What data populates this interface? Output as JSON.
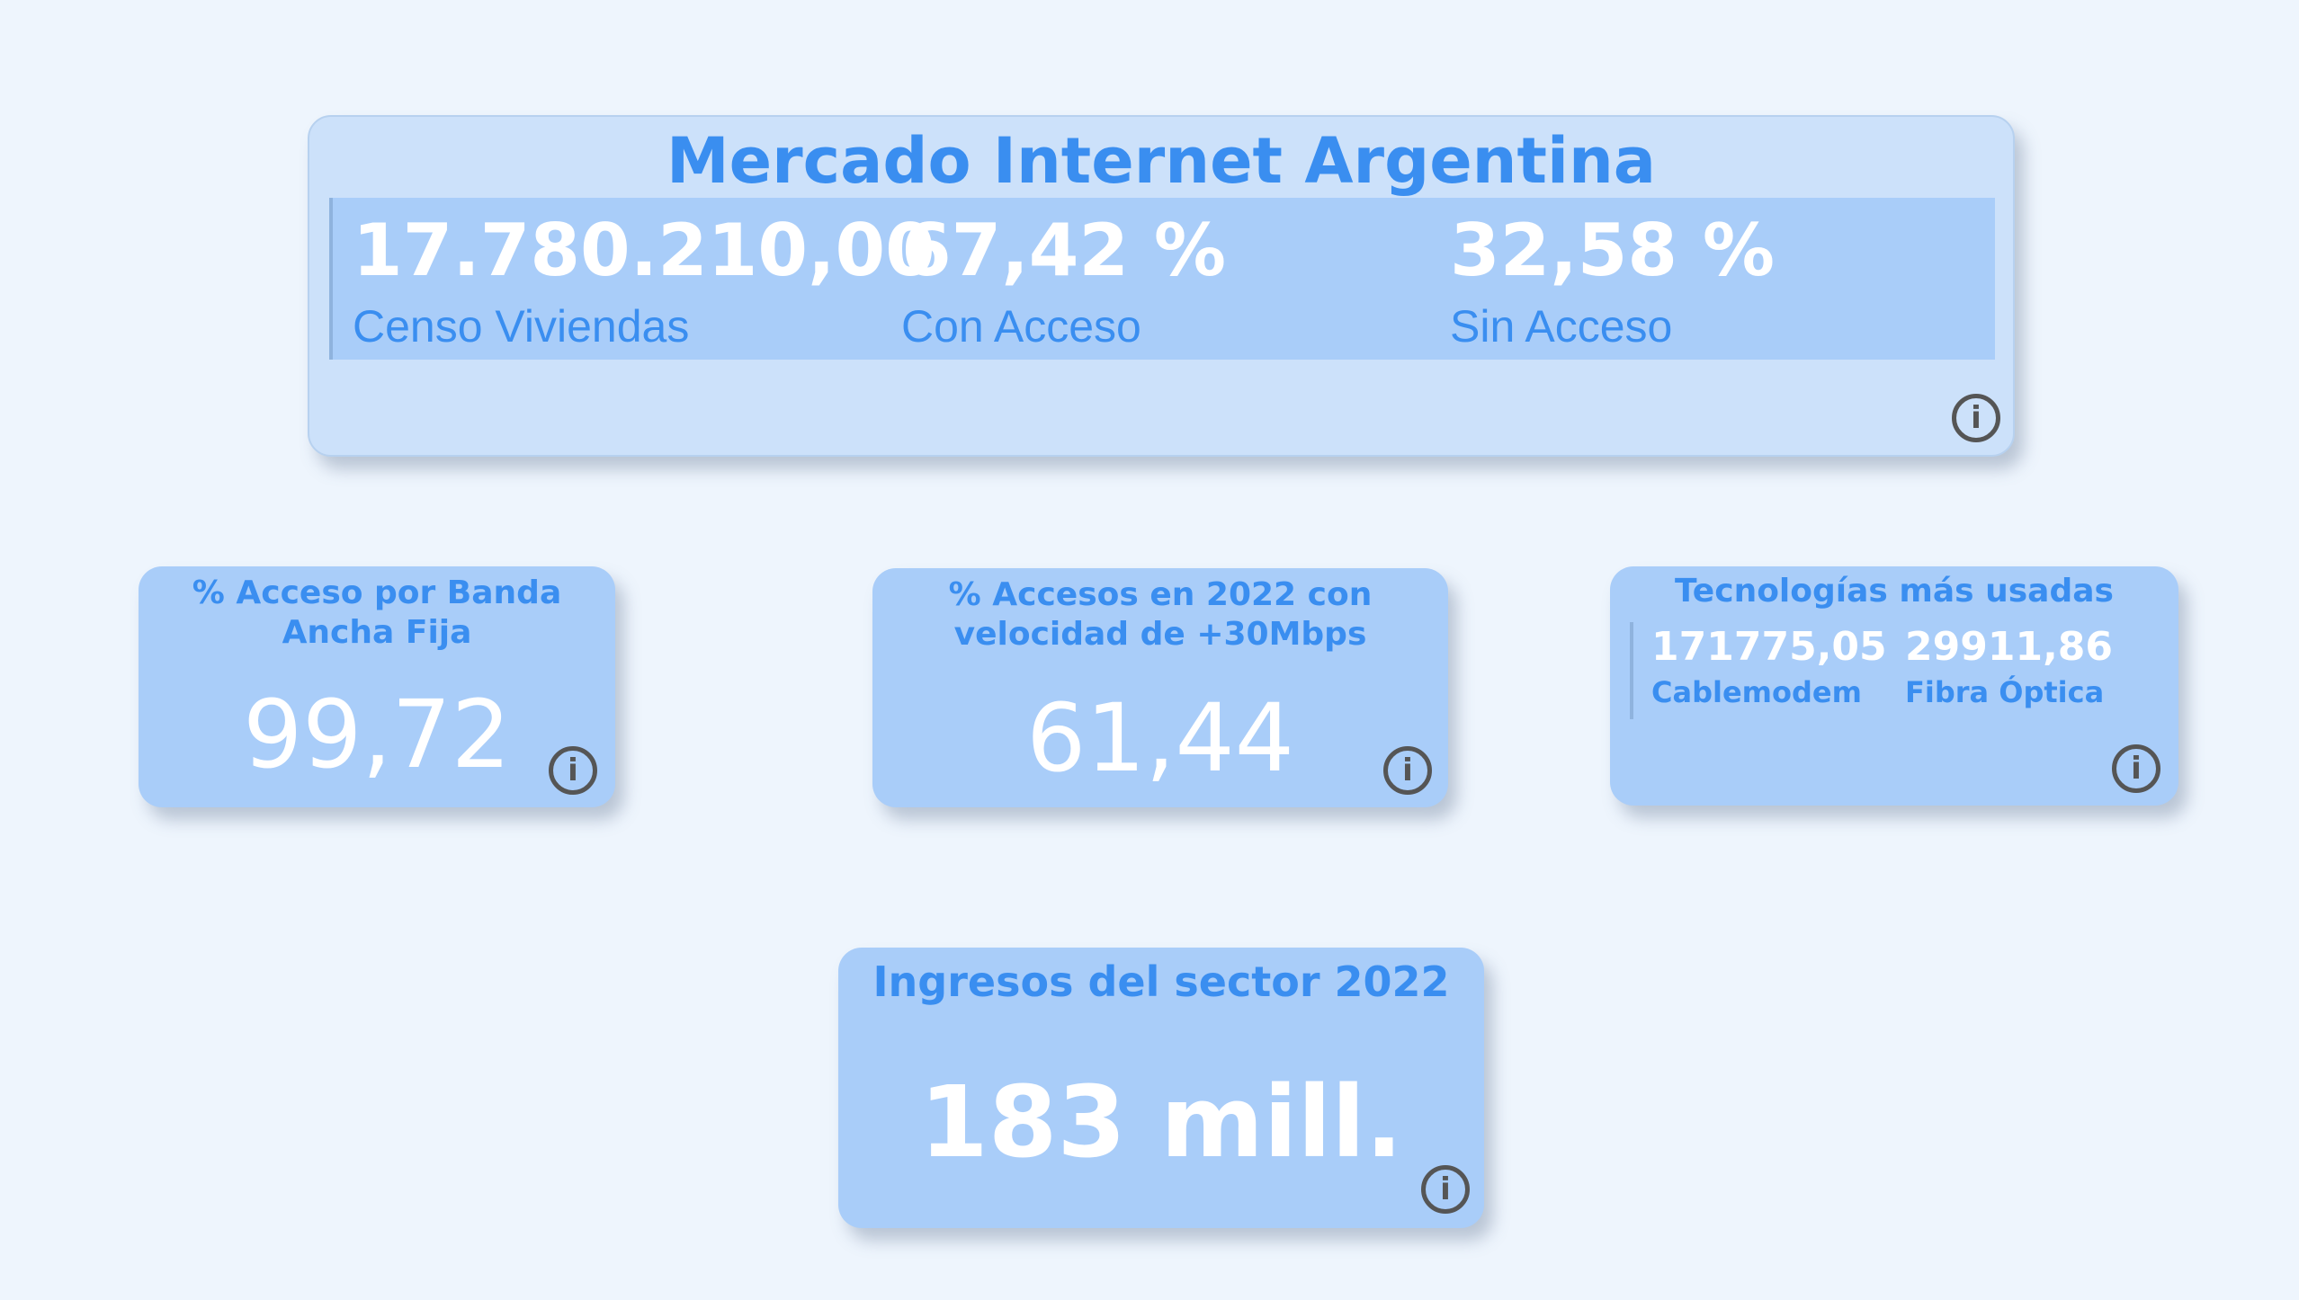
{
  "header": {
    "title": "Mercado Internet Argentina",
    "kpis": [
      {
        "value": "17.780.210,00",
        "label": "Censo Viviendas"
      },
      {
        "value": "67,42 %",
        "label": "Con Acceso"
      },
      {
        "value": "32,58 %",
        "label": "Sin Acceso"
      }
    ]
  },
  "broadband": {
    "title": "% Acceso por Banda Ancha Fija",
    "value": "99,72"
  },
  "speed": {
    "title": "% Accesos en 2022 con velocidad de +30Mbps",
    "value": "61,44"
  },
  "technologies": {
    "title": "Tecnologías más usadas",
    "items": [
      {
        "value": "171775,05",
        "label": "Cablemodem"
      },
      {
        "value": "29911,86",
        "label": "Fibra Óptica"
      }
    ]
  },
  "revenue": {
    "title": "Ingresos del sector 2022",
    "value": "183 mill."
  },
  "icons": {
    "info": "info-icon",
    "info_glyph": "i"
  },
  "colors": {
    "background": "#eef5fd",
    "card": "#a9cdf9",
    "header_card": "#cce1fa",
    "title": "#3a8ef0",
    "value": "#ffffff",
    "icon": "#555555"
  }
}
